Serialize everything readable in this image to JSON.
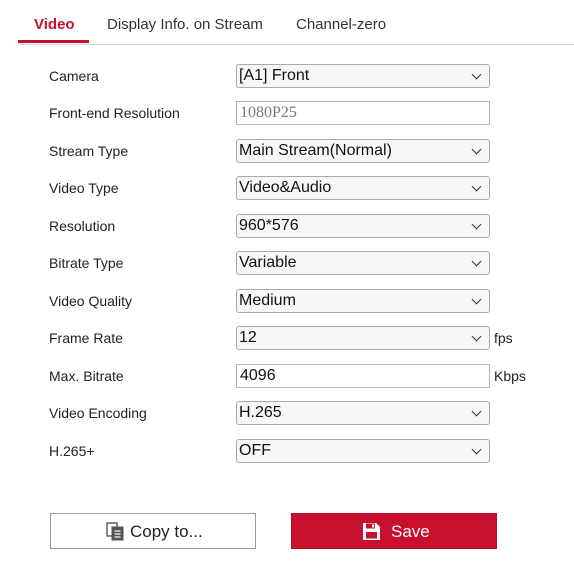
{
  "tabs": [
    {
      "label": "Video"
    },
    {
      "label": "Display Info. on Stream"
    },
    {
      "label": "Channel-zero"
    }
  ],
  "form": {
    "camera": {
      "label": "Camera",
      "value": "[A1] Front"
    },
    "frontend_resolution": {
      "label": "Front-end Resolution",
      "value": "1080P25"
    },
    "stream_type": {
      "label": "Stream Type",
      "value": "Main Stream(Normal)"
    },
    "video_type": {
      "label": "Video Type",
      "value": "Video&Audio"
    },
    "resolution": {
      "label": "Resolution",
      "value": "960*576"
    },
    "bitrate_type": {
      "label": "Bitrate Type",
      "value": "Variable"
    },
    "video_quality": {
      "label": "Video Quality",
      "value": "Medium"
    },
    "frame_rate": {
      "label": "Frame Rate",
      "value": "12",
      "unit": "fps"
    },
    "max_bitrate": {
      "label": "Max. Bitrate",
      "value": "4096",
      "unit": "Kbps"
    },
    "video_encoding": {
      "label": "Video Encoding",
      "value": "H.265"
    },
    "h265plus": {
      "label": "H.265+",
      "value": "OFF"
    }
  },
  "buttons": {
    "copy_label": "Copy to...",
    "copy_icon": "copy-icon",
    "save_label": "Save",
    "save_icon": "floppy-disk-icon"
  },
  "colors": {
    "accent": "#c8102e"
  }
}
